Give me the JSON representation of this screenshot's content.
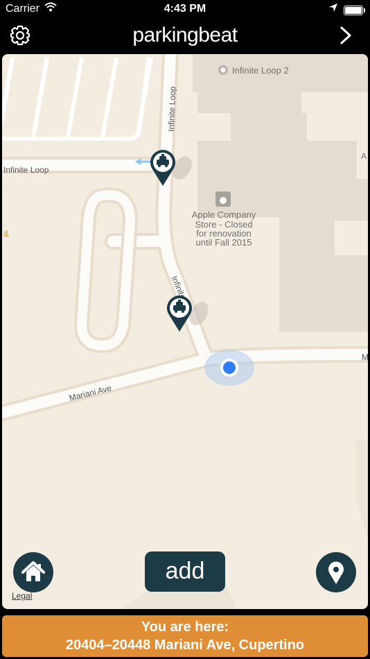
{
  "status_bar": {
    "carrier": "Carrier",
    "time": "4:43 PM"
  },
  "nav": {
    "brand_prefix": "parking",
    "brand_suffix": "beat"
  },
  "map": {
    "labels": {
      "infinite_loop_2": "Infinite Loop 2",
      "infinite_loop_road_vertical": "Infinite Loop",
      "infinite_loop_road_horizontal": "Infinite Loop",
      "infinite_loop_road_diagonal": "Infinite Lo",
      "apple_store_line1": "Apple Company",
      "apple_store_line2": "Store - Closed",
      "apple_store_line3": "for renovation",
      "apple_store_line4": "until Fall 2015",
      "mariani_ave": "Mariani Ave",
      "edge_right_a": "A",
      "edge_right_m": "M",
      "edge_left_amp": "&"
    },
    "legal": "Legal"
  },
  "buttons": {
    "add_label": "add"
  },
  "footer": {
    "line1": "You are here:",
    "line2": "20404–20448 Mariani Ave, Cupertino"
  },
  "colors": {
    "accent": "#e08e36",
    "button_bg": "#1d3b47",
    "map_bg": "#f3ece1",
    "user_dot": "#2e7cf6"
  }
}
